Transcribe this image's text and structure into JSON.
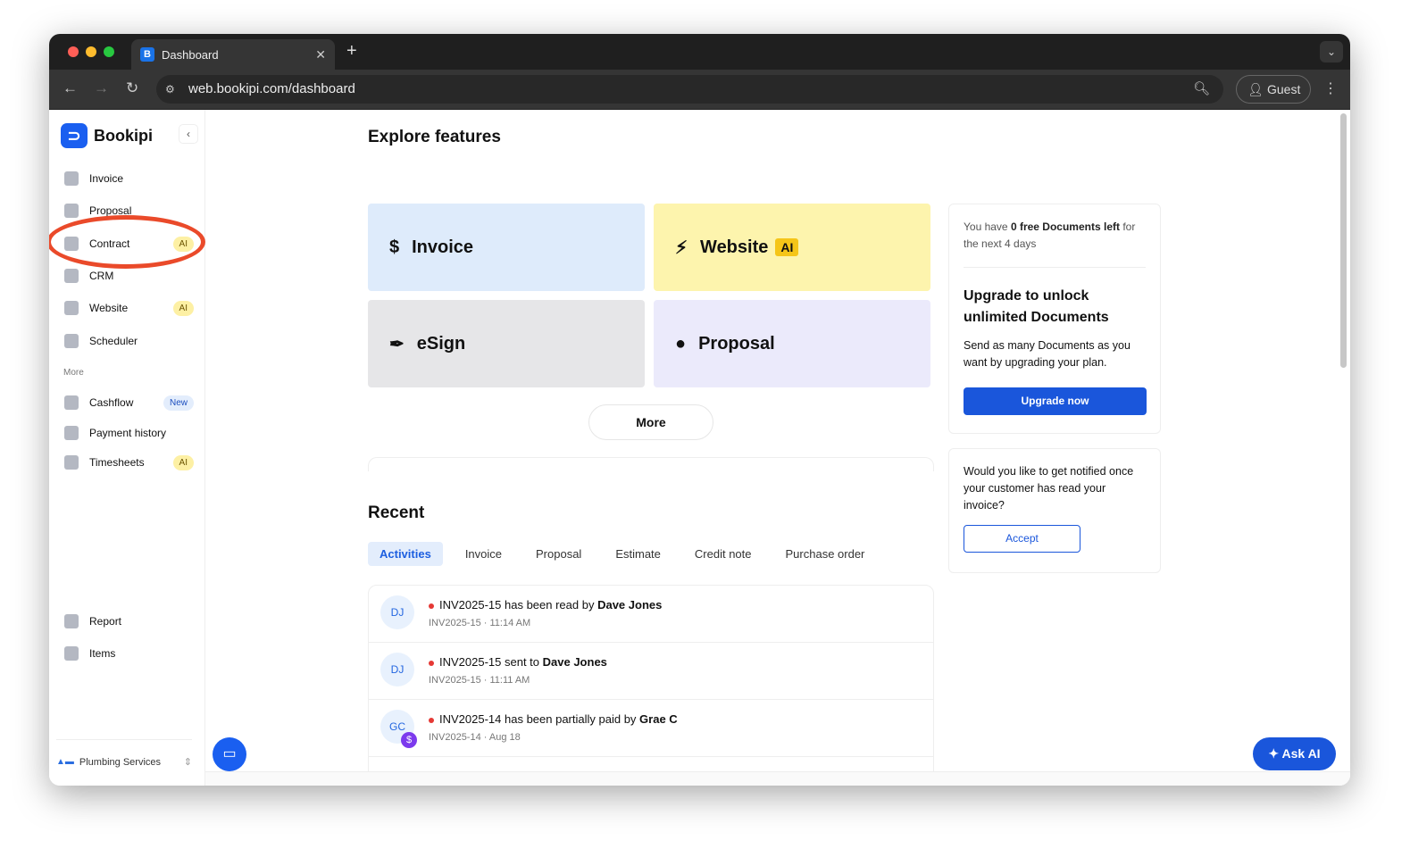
{
  "browser": {
    "tab_title": "Dashboard",
    "url": "web.bookipi.com/dashboard",
    "profile": "Guest"
  },
  "sidebar": {
    "brand": "Bookipi",
    "items": [
      {
        "label": "Invoice"
      },
      {
        "label": "Proposal"
      },
      {
        "label": "Contract",
        "badge": "AI"
      },
      {
        "label": "CRM"
      },
      {
        "label": "Website",
        "badge": "AI"
      },
      {
        "label": "Scheduler"
      }
    ],
    "more_label": "More",
    "more_items": [
      {
        "label": "Cashflow",
        "badge": "New"
      },
      {
        "label": "Payment history"
      },
      {
        "label": "Timesheets",
        "badge": "AI"
      }
    ],
    "bottom_items": [
      {
        "label": "Report"
      },
      {
        "label": "Items"
      }
    ],
    "business": "Plumbing Services"
  },
  "annotation_color": "#ea4a2a",
  "explore": {
    "title": "Explore features",
    "cards": [
      {
        "label": "Invoice",
        "icon": "dollar-icon"
      },
      {
        "label": "Website",
        "badge": "AI",
        "icon": "lightning-icon"
      },
      {
        "label": "eSign",
        "icon": "pen-icon"
      },
      {
        "label": "Proposal",
        "icon": "bulb-icon"
      }
    ],
    "more": "More"
  },
  "recent": {
    "title": "Recent",
    "tabs": [
      "Activities",
      "Invoice",
      "Proposal",
      "Estimate",
      "Credit note",
      "Purchase order"
    ],
    "active_tab": "Activities",
    "rows": [
      {
        "initials": "DJ",
        "pre": "INV2025-15 has been read by ",
        "name": "Dave Jones",
        "sub": "INV2025-15 · 11:14 AM"
      },
      {
        "initials": "DJ",
        "pre": "INV2025-15 sent to ",
        "name": "Dave Jones",
        "sub": "INV2025-15 · 11:11 AM"
      },
      {
        "initials": "GC",
        "pre": "INV2025-14 has been partially paid by ",
        "name": "Grae C",
        "sub": "INV2025-14 · Aug 18",
        "payment_badge": "$"
      }
    ]
  },
  "upgrade": {
    "line_pre": "You have ",
    "line_bold": "0 free Documents left",
    "line_post": " for the next 4 days",
    "title": "Upgrade to unlock unlimited Documents",
    "body": "Send as many Documents as you want by upgrading your plan.",
    "button": "Upgrade now"
  },
  "notify": {
    "text": "Would you like to get notified once your customer has read your invoice?",
    "button": "Accept"
  },
  "ask_ai": "Ask AI"
}
